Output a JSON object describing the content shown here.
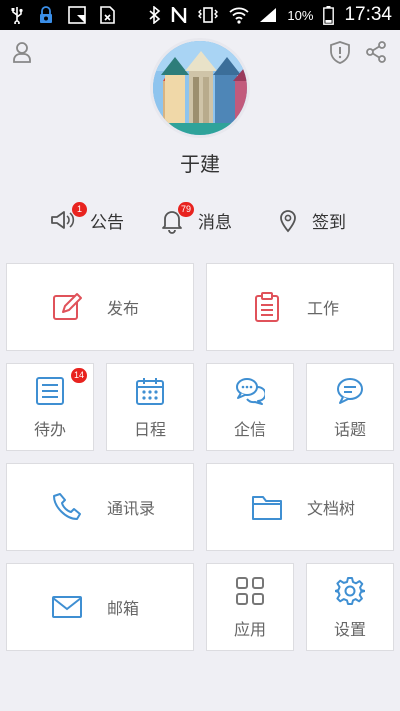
{
  "status_bar": {
    "battery_percent": "10%",
    "time": "17:34"
  },
  "header": {
    "user_name": "于建",
    "icons": [
      "person-icon",
      "shield-icon",
      "share-icon"
    ]
  },
  "quick_links": [
    {
      "label": "公告",
      "icon": "speaker-icon",
      "badge": "1"
    },
    {
      "label": "消息",
      "icon": "bell-icon",
      "badge": "79"
    },
    {
      "label": "签到",
      "icon": "location-pin-icon",
      "badge": ""
    }
  ],
  "tiles": {
    "publish": {
      "label": "发布",
      "icon": "edit-icon",
      "color": "#e0525a"
    },
    "work": {
      "label": "工作",
      "icon": "clipboard-icon",
      "color": "#e0525a"
    },
    "todo": {
      "label": "待办",
      "icon": "list-icon",
      "color": "#3f8fd2",
      "badge": "14"
    },
    "schedule": {
      "label": "日程",
      "icon": "calendar-icon",
      "color": "#3f8fd2"
    },
    "messenger": {
      "label": "企信",
      "icon": "chat-bubbles-icon",
      "color": "#3f8fd2"
    },
    "topics": {
      "label": "话题",
      "icon": "chat-icon",
      "color": "#3f8fd2"
    },
    "contacts": {
      "label": "通讯录",
      "icon": "phone-icon",
      "color": "#3f8fd2"
    },
    "documents": {
      "label": "文档树",
      "icon": "folder-icon",
      "color": "#3f8fd2"
    },
    "mail": {
      "label": "邮箱",
      "icon": "envelope-icon",
      "color": "#3f8fd2"
    },
    "apps": {
      "label": "应用",
      "icon": "grid-icon",
      "color": "#777777"
    },
    "settings": {
      "label": "设置",
      "icon": "gear-icon",
      "color": "#3f8fd2"
    }
  }
}
